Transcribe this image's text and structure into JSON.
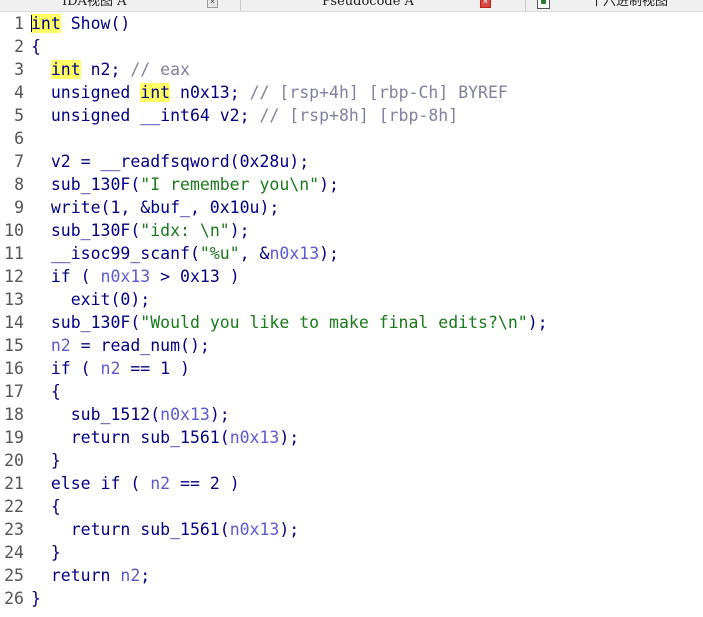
{
  "tabs": [
    {
      "label": "IDA视图 A"
    },
    {
      "label": "Pseudocode A"
    },
    {
      "label": "十六进制视图"
    }
  ],
  "code": {
    "lines": [
      {
        "n": "1",
        "t": [
          [
            "int",
            "kw hl"
          ],
          [
            " Show()",
            "kw"
          ]
        ]
      },
      {
        "n": "2",
        "t": [
          [
            "{",
            "kw"
          ]
        ]
      },
      {
        "n": "3",
        "t": [
          [
            "  ",
            "kw"
          ],
          [
            "int",
            "kw hl"
          ],
          [
            " n2; ",
            "kw"
          ],
          [
            "// eax",
            "cm"
          ]
        ]
      },
      {
        "n": "4",
        "t": [
          [
            "  unsigned ",
            "kw"
          ],
          [
            "int",
            "kw hl"
          ],
          [
            " n0x13; ",
            "kw"
          ],
          [
            "// [rsp+4h] [rbp-Ch] BYREF",
            "cm"
          ]
        ]
      },
      {
        "n": "5",
        "t": [
          [
            "  unsigned __int64 v2; ",
            "kw"
          ],
          [
            "// [rsp+8h] [rbp-8h]",
            "cm"
          ]
        ]
      },
      {
        "n": "6",
        "t": []
      },
      {
        "n": "7",
        "t": [
          [
            "  v2 = __readfsqword(0x28u);",
            "kw"
          ]
        ]
      },
      {
        "n": "8",
        "t": [
          [
            "  sub_130F(",
            "kw"
          ],
          [
            "\"I remember you\\n\"",
            "str"
          ],
          [
            ");",
            "kw"
          ]
        ]
      },
      {
        "n": "9",
        "t": [
          [
            "  write(1, &buf_, 0x10u);",
            "kw"
          ]
        ]
      },
      {
        "n": "10",
        "t": [
          [
            "  sub_130F(",
            "kw"
          ],
          [
            "\"idx: \\n\"",
            "str"
          ],
          [
            ");",
            "kw"
          ]
        ]
      },
      {
        "n": "11",
        "t": [
          [
            "  __isoc99_scanf(",
            "kw"
          ],
          [
            "\"%u\"",
            "str"
          ],
          [
            ", &",
            "kw"
          ],
          [
            "n0x13",
            "var"
          ],
          [
            ");",
            "kw"
          ]
        ]
      },
      {
        "n": "12",
        "t": [
          [
            "  if ( ",
            "kw"
          ],
          [
            "n0x13",
            "var"
          ],
          [
            " > 0x13 )",
            "kw"
          ]
        ]
      },
      {
        "n": "13",
        "t": [
          [
            "    exit(0);",
            "kw"
          ]
        ]
      },
      {
        "n": "14",
        "t": [
          [
            "  sub_130F(",
            "kw"
          ],
          [
            "\"Would you like to make final edits?\\n\"",
            "str"
          ],
          [
            ");",
            "kw"
          ]
        ]
      },
      {
        "n": "15",
        "t": [
          [
            "  ",
            "kw"
          ],
          [
            "n2",
            "var"
          ],
          [
            " = read_num();",
            "kw"
          ]
        ]
      },
      {
        "n": "16",
        "t": [
          [
            "  if ( ",
            "kw"
          ],
          [
            "n2",
            "var"
          ],
          [
            " == 1 )",
            "kw"
          ]
        ]
      },
      {
        "n": "17",
        "t": [
          [
            "  {",
            "kw"
          ]
        ]
      },
      {
        "n": "18",
        "t": [
          [
            "    sub_1512(",
            "kw"
          ],
          [
            "n0x13",
            "var"
          ],
          [
            ");",
            "kw"
          ]
        ]
      },
      {
        "n": "19",
        "t": [
          [
            "    return sub_1561(",
            "kw"
          ],
          [
            "n0x13",
            "var"
          ],
          [
            ");",
            "kw"
          ]
        ]
      },
      {
        "n": "20",
        "t": [
          [
            "  }",
            "kw"
          ]
        ]
      },
      {
        "n": "21",
        "t": [
          [
            "  else if ( ",
            "kw"
          ],
          [
            "n2",
            "var"
          ],
          [
            " == 2 )",
            "kw"
          ]
        ]
      },
      {
        "n": "22",
        "t": [
          [
            "  {",
            "kw"
          ]
        ]
      },
      {
        "n": "23",
        "t": [
          [
            "    return sub_1561(",
            "kw"
          ],
          [
            "n0x13",
            "var"
          ],
          [
            ");",
            "kw"
          ]
        ]
      },
      {
        "n": "24",
        "t": [
          [
            "  }",
            "kw"
          ]
        ]
      },
      {
        "n": "25",
        "t": [
          [
            "  return ",
            "kw"
          ],
          [
            "n2",
            "var"
          ],
          [
            ";",
            "kw"
          ]
        ]
      },
      {
        "n": "26",
        "t": [
          [
            "}",
            "kw"
          ]
        ]
      }
    ]
  },
  "icons": {
    "close": "close-icon",
    "hex_view": "hex-view-icon"
  },
  "colors": {
    "keyword": "#000080",
    "variable": "#5a5ad0",
    "comment": "#8080a0",
    "string": "#1a7a1a",
    "highlight": "#ffff66"
  }
}
